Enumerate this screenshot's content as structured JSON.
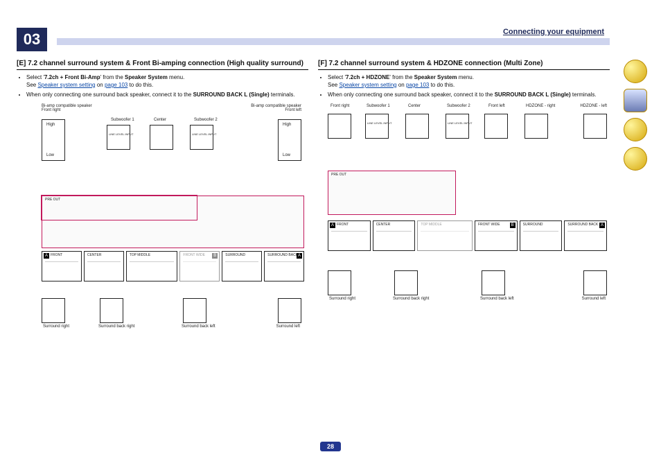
{
  "chapter_number": "03",
  "section_title": "Connecting your equipment",
  "page_number": "28",
  "colE": {
    "heading": "[E] 7.2 channel surround system & Front Bi-amping connection (High quality surround)",
    "b1a": "Select '",
    "b1b": "7.2ch + Front Bi-Amp",
    "b1c": "' from the ",
    "b1d": "Speaker System",
    "b1e": " menu.",
    "b1_see": "See ",
    "b1_link": "Speaker system setting",
    "b1_on": " on ",
    "b1_page": "page 103",
    "b1_tail": " to do this.",
    "b2a": "When only connecting one surround back speaker, connect it to the ",
    "b2b": "SURROUND BACK L (Single)",
    "b2c": " terminals.",
    "labels": {
      "biamp_r": "Bi-amp compatible speaker\nFront right",
      "biamp_l": "Bi-amp compatible speaker\nFront left",
      "sub1": "Subwoofer 1",
      "sub2": "Subwoofer 2",
      "center": "Center",
      "sr_r": "Surround right",
      "sb_r": "Surround back right",
      "sb_l": "Surround back left",
      "sr_l": "Surround left",
      "t_front": "FRONT",
      "t_center": "CENTER",
      "t_tm": "TOP MIDDLE",
      "t_fw": "FRONT WIDE",
      "t_surr": "SURROUND",
      "t_sb": "SURROUND BACK",
      "preout": "PRE OUT",
      "line_level": "LINE LEVEL INPUT",
      "high": "High",
      "low": "Low",
      "tagA": "A",
      "tagB": "B"
    }
  },
  "colF": {
    "heading": "[F] 7.2 channel surround system & HDZONE connection (Multi Zone)",
    "b1a": "Select '",
    "b1b": "7.2ch + HDZONE",
    "b1c": "' from the ",
    "b1d": "Speaker System",
    "b1e": " menu.",
    "b1_see": "See ",
    "b1_link": "Speaker system setting",
    "b1_on": " on ",
    "b1_page": "page 103",
    "b1_tail": " to do this.",
    "b2a": "When only connecting one surround back speaker, connect it to the ",
    "b2b": "SURROUND BACK L (Single)",
    "b2c": " terminals.",
    "labels": {
      "fr": "Front right",
      "fl": "Front left",
      "sub1": "Subwoofer 1",
      "sub2": "Subwoofer 2",
      "center": "Center",
      "hz_r": "HDZONE - right",
      "hz_l": "HDZONE - left",
      "sr_r": "Surround right",
      "sb_r": "Surround back right",
      "sb_l": "Surround back left",
      "sr_l": "Surround left",
      "t_front": "FRONT",
      "t_center": "CENTER",
      "t_tm": "TOP MIDDLE",
      "t_fw": "FRONT WIDE",
      "t_surr": "SURROUND",
      "t_sb": "SURROUND BACK",
      "preout": "PRE OUT",
      "line_level": "LINE LEVEL INPUT",
      "tagA": "A",
      "tagB": "B"
    }
  },
  "sidebar": {
    "icon1": "book-icon",
    "icon2": "screen-icon",
    "icon3": "help-icon",
    "icon4": "tools-icon"
  }
}
